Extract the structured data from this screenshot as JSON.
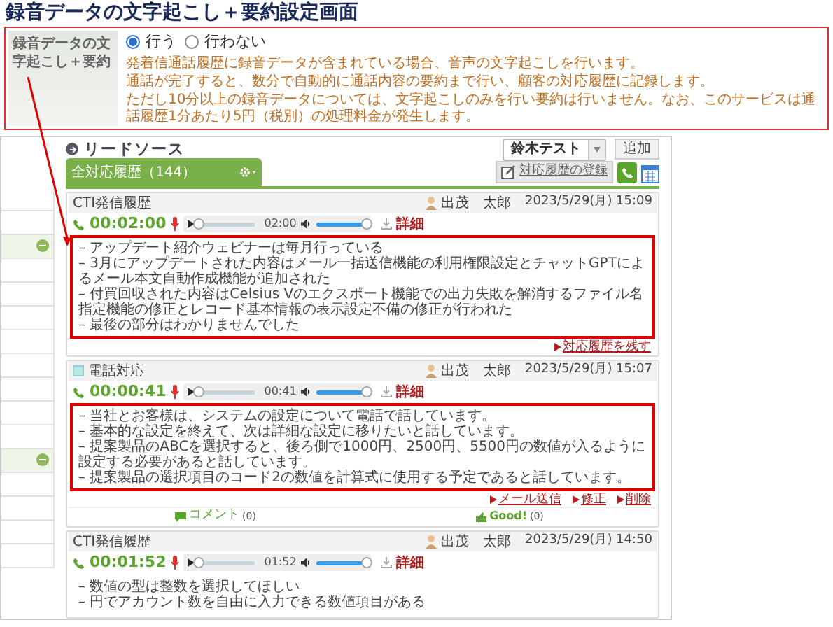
{
  "page_title": "録音データの文字起こし＋要約設定画面",
  "setting": {
    "label": "録音データの文字起こし＋要約",
    "options": [
      {
        "label": "行う",
        "selected": true
      },
      {
        "label": "行わない",
        "selected": false
      }
    ],
    "notes": [
      "発着信通話履歴に録音データが含まれている場合、音声の文字起こしを行います。",
      "通話が完了すると、数分で自動的に通話内容の要約まで行い、顧客の対応履歴に記録します。",
      "ただし10分以上の録音データについては、文字起こしのみを行い要約は行いません。なお、このサービスは通話履歴1分あたり5円（税別）の処理料金が発生します。"
    ]
  },
  "app": {
    "section_title": "リードソース",
    "user_select": "鈴木テスト",
    "add_button": "追加",
    "tab": {
      "label": "全対応履歴（144）",
      "selected": true
    },
    "register_button": "対応履歴の登録",
    "records": [
      {
        "kind": "cti",
        "type": "CTI発信履歴",
        "staff": "出茂　太郎",
        "datetime": "2023/5/29(月) 15:09",
        "duration": "00:02:00",
        "progress": {
          "level": 0
        },
        "position": "02:00",
        "volume": {
          "level": 1
        },
        "detail": "詳細",
        "highlighted": true,
        "summary": [
          "– アップデート紹介ウェビナーは毎月行っている",
          "– 3月にアップデートされた内容はメール一括送信機能の利用権限設定とチャットGPTによるメール本文自動作成機能が追加された",
          "– 付買回収された内容はCelsius Vのエクスポート機能での出力失敗を解消するファイル名指定機能の修正とレコード基本情報の表示設定不備の修正が行われた",
          "– 最後の部分はわかりませんでした"
        ],
        "links": [
          "対応履歴を残す"
        ]
      },
      {
        "kind": "call",
        "type": "電話対応",
        "staff": "出茂　太郎",
        "datetime": "2023/5/29(月) 15:07",
        "duration": "00:00:41",
        "progress": {
          "level": 0
        },
        "position": "00:41",
        "volume": {
          "level": 1
        },
        "detail": "詳細",
        "highlighted": true,
        "summary": [
          "– 当社とお客様は、システムの設定について電話で話しています。",
          "– 基本的な設定を終えて、次は詳細な設定に移りたいと話しています。",
          "– 提案製品のABCを選択すると、後ろ側で1000円、2500円、5500円の数値が入るように設定する必要があると話しています。",
          "– 提案製品の選択項目のコード2の数値を計算式に使用する予定であると話しています。"
        ],
        "links": [
          "メール送信",
          "修正",
          "削除"
        ],
        "comment": {
          "label": "コメント",
          "count": "(0)"
        },
        "good": {
          "label": "Good!",
          "count": "(0)"
        }
      },
      {
        "kind": "cti",
        "type": "CTI発信履歴",
        "staff": "出茂　太郎",
        "datetime": "2023/5/29(月) 14:50",
        "duration": "00:01:52",
        "progress": {
          "level": 0
        },
        "position": "01:52",
        "volume": {
          "level": 1
        },
        "detail": "詳細",
        "highlighted": false,
        "summary": [
          "– 数値の型は整数を選択してほしい",
          "– 円でアカウント数を自由に入力できる数値項目がある"
        ]
      }
    ]
  }
}
